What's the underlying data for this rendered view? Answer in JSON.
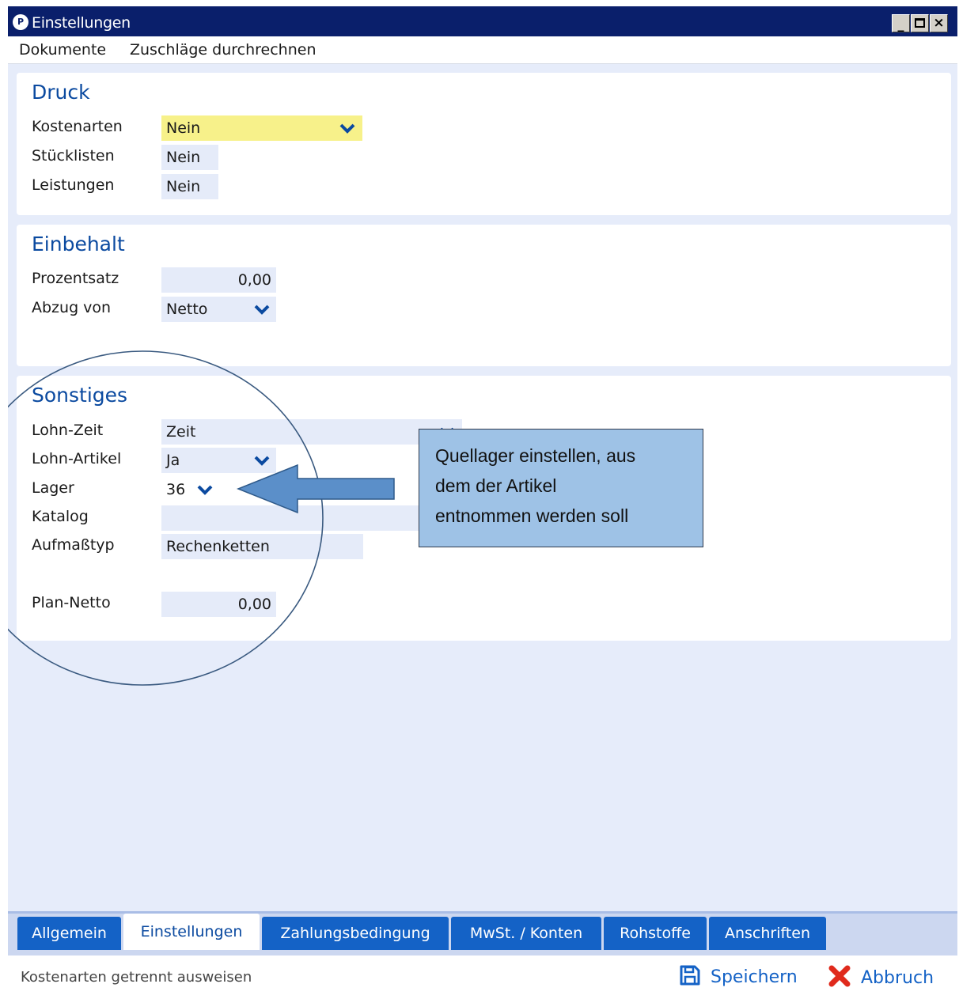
{
  "window": {
    "title": "Einstellungen",
    "app_icon": "app-logo-icon",
    "controls": [
      "minimize-icon",
      "maximize-icon",
      "close-icon"
    ]
  },
  "menu": [
    {
      "label": "Dokumente"
    },
    {
      "label": "Zuschläge durchrechnen"
    }
  ],
  "sections": {
    "druck": {
      "title": "Druck",
      "fields": {
        "kostenarten": {
          "label": "Kostenarten",
          "value": "Nein"
        },
        "stuecklisten": {
          "label": "Stücklisten",
          "value": "Nein"
        },
        "leistungen": {
          "label": "Leistungen",
          "value": "Nein"
        }
      }
    },
    "einbehalt": {
      "title": "Einbehalt",
      "fields": {
        "prozentsatz": {
          "label": "Prozentsatz",
          "value": "0,00"
        },
        "abzug": {
          "label": "Abzug von",
          "value": "Netto"
        }
      }
    },
    "sonstiges": {
      "title": "Sonstiges",
      "fields": {
        "lohn_zeit": {
          "label": "Lohn-Zeit",
          "value": "Zeit"
        },
        "lohn_artikel": {
          "label": "Lohn-Artikel",
          "value": "Ja"
        },
        "lager": {
          "label": "Lager",
          "value": "36"
        },
        "katalog": {
          "label": "Katalog",
          "value": ""
        },
        "aufmasstyp": {
          "label": "Aufmaßtyp",
          "value": "Rechenketten"
        },
        "plan_netto": {
          "label": "Plan-Netto",
          "value": "0,00"
        }
      }
    }
  },
  "annotation": {
    "callout_lines": [
      "Quellager einstellen, aus",
      "dem der Artikel",
      "entnommen werden soll"
    ],
    "arrow_color": "#5b8fc9",
    "circle_color": "#3a5a80"
  },
  "tabs": [
    {
      "label": "Allgemein",
      "active": false
    },
    {
      "label": "Einstellungen",
      "active": true
    },
    {
      "label": "Zahlungsbedingung",
      "active": false
    },
    {
      "label": "MwSt. / Konten",
      "active": false
    },
    {
      "label": "Rohstoffe",
      "active": false
    },
    {
      "label": "Anschriften",
      "active": false
    }
  ],
  "status": {
    "text": "Kostenarten getrennt ausweisen",
    "save_label": "Speichern",
    "cancel_label": "Abbruch",
    "save_icon": "floppy-disk-icon",
    "cancel_icon": "red-x-icon"
  },
  "colors": {
    "titlebar": "#0a1f6b",
    "accent_blue": "#1462c6",
    "section_title": "#0b4aa0",
    "highlight_field": "#f7f18a",
    "field_bg": "#e5ebf9",
    "panel_bg": "#e6ecfa",
    "cancel_red": "#e02a1c"
  }
}
